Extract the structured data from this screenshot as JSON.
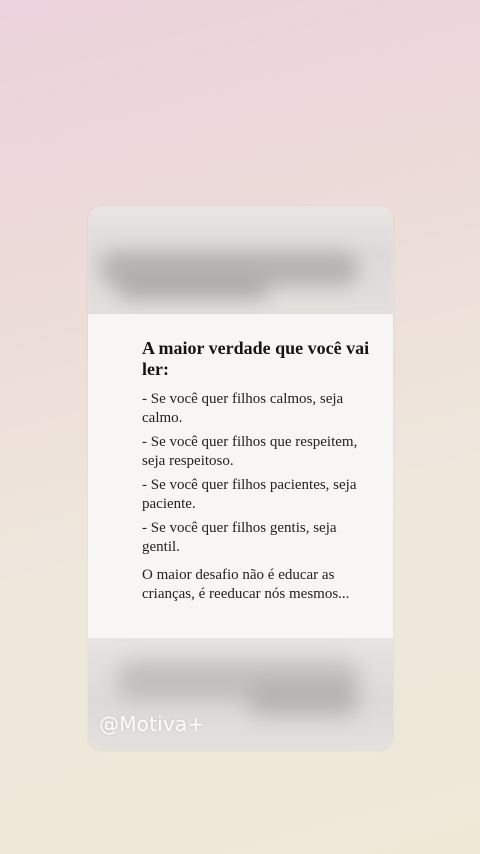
{
  "post": {
    "title": "A maior verdade que você vai ler:",
    "items": [
      "- Se você quer filhos calmos, seja calmo.",
      "- Se você quer filhos que respeitem, seja respeitoso.",
      "- Se você quer filhos pacientes, seja paciente.",
      "- Se você quer filhos gentis, seja gentil."
    ],
    "closing": "O maior desafio não é educar as crianças, é reeducar nós mesmos...",
    "watermark": "@Motiva+"
  }
}
